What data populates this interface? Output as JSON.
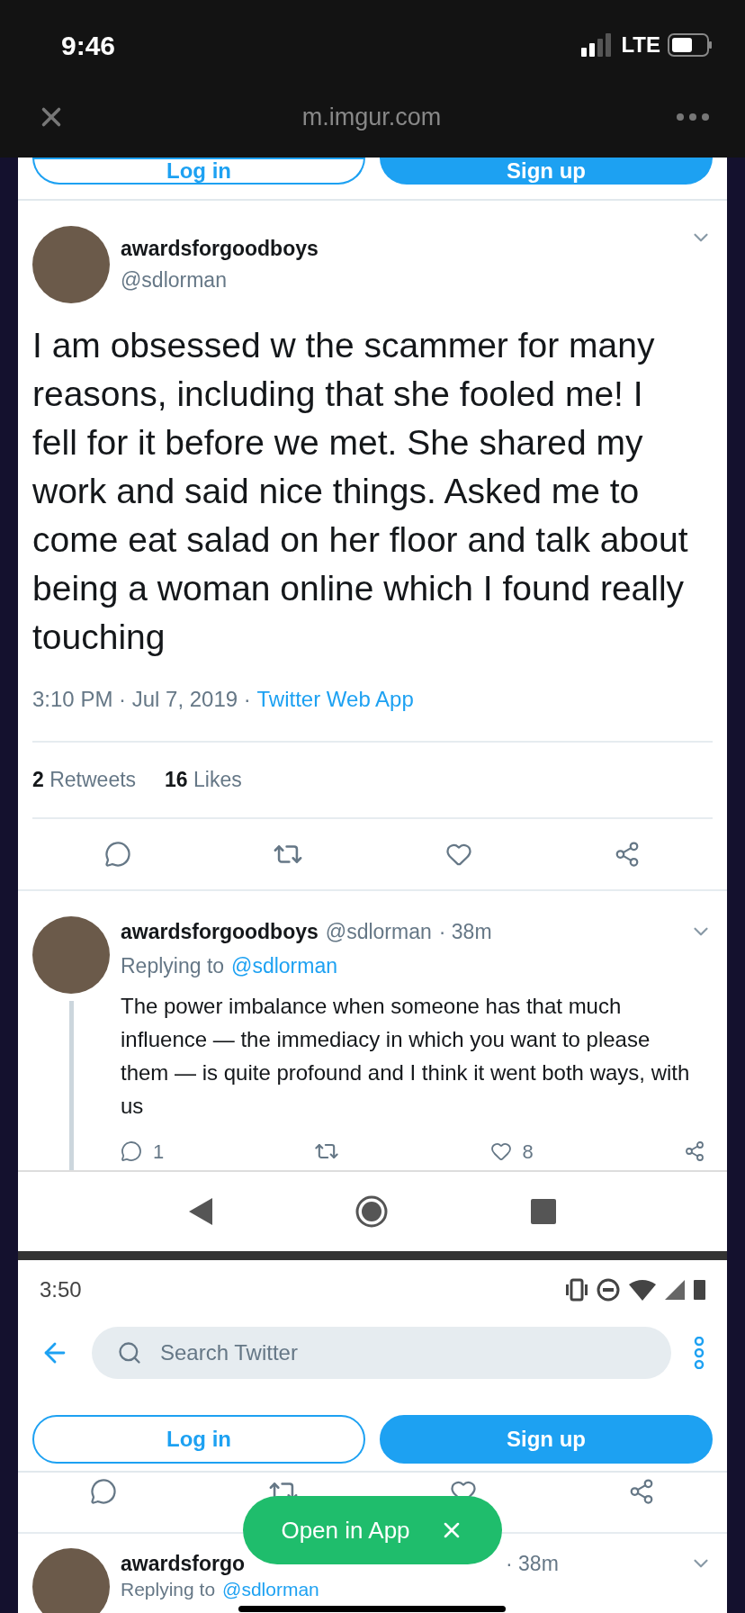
{
  "ios_status_bar": {
    "time": "9:46",
    "network": "LTE"
  },
  "browser_bar": {
    "url": "m.imgur.com"
  },
  "screenshot_1": {
    "auth_buttons": [
      {
        "label": "Log in",
        "kind": "outline"
      },
      {
        "label": "Sign up",
        "kind": "filled"
      }
    ],
    "tweet": {
      "name": "awardsforgoodboys",
      "handle": "@sdlorman",
      "text": "I am obsessed w the scammer for many reasons, including that she fooled me! I fell for it before we met. She shared my work and said nice things. Asked me to come eat salad on her floor and talk about being a woman online which I found really touching",
      "timestamp": "3:10 PM · Jul 7, 2019 · ",
      "source": "Twitter Web App",
      "retweets": "2",
      "retweets_label": "Retweets",
      "likes": "16",
      "likes_label": "Likes"
    },
    "reply": {
      "name": "awardsforgoodboys",
      "handle": "@sdlorman",
      "time": "· 38m",
      "replying_label": "Replying to",
      "replying_handle": "@sdlorman",
      "text": "The power imbalance when someone has that much influence — the immediacy in which you want to please them — is quite profound and I think it went both ways, with us",
      "reply_count": "1",
      "like_count": "8"
    }
  },
  "screenshot_2": {
    "time": "3:50",
    "search": {
      "placeholder": "Search Twitter"
    },
    "auth_buttons": [
      {
        "label": "Log in",
        "kind": "outline"
      },
      {
        "label": "Sign up",
        "kind": "filled"
      }
    ],
    "reply": {
      "name": "awardsforgo",
      "time": "· 38m",
      "replying_label": "Replying to",
      "replying_handle": "@sdlorman"
    }
  },
  "open_in_app": {
    "label": "Open in App"
  }
}
